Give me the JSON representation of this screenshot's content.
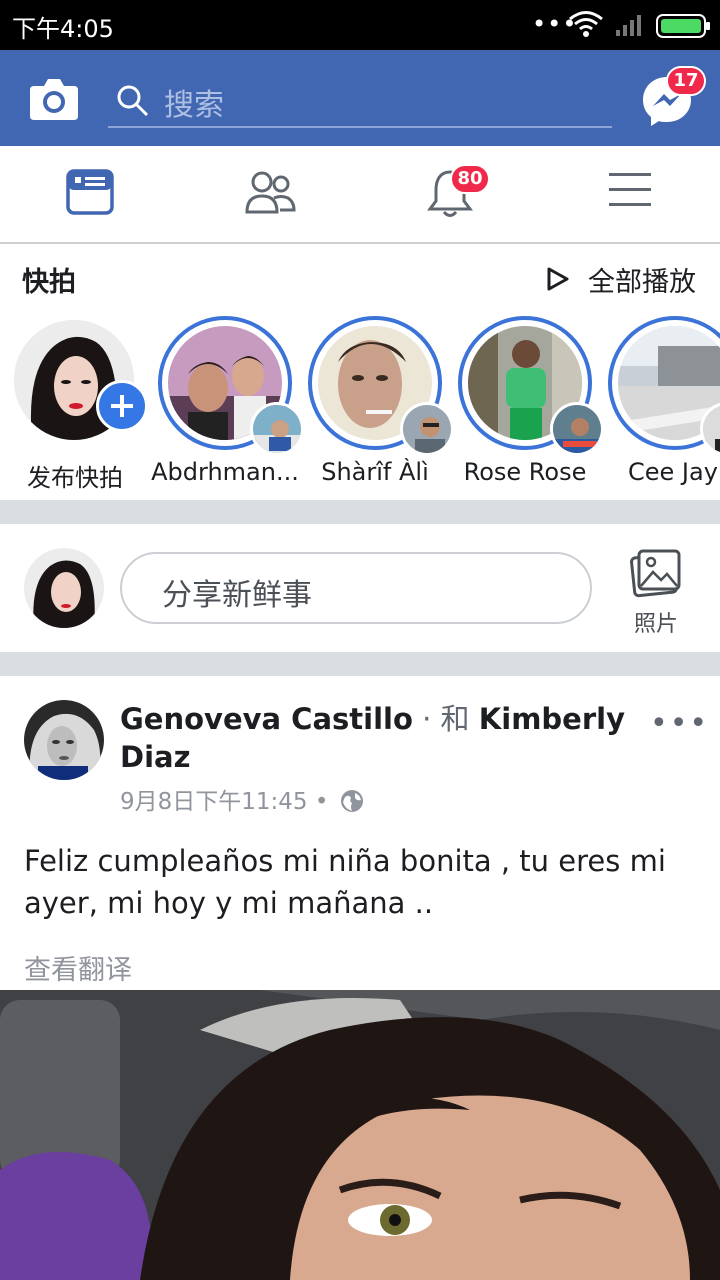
{
  "status_bar": {
    "time": "下午4:05",
    "dots": "•••"
  },
  "top_bar": {
    "search_placeholder": "搜索",
    "messenger_badge": "17"
  },
  "nav": {
    "notifications_badge": "80"
  },
  "stories": {
    "title": "快拍",
    "play_all": "全部播放",
    "items": [
      {
        "label": "发布快拍"
      },
      {
        "label": "Abdrhman..."
      },
      {
        "label": "Shàrîf Àlì"
      },
      {
        "label": "Rose Rose"
      },
      {
        "label": "Cee Jay"
      }
    ]
  },
  "composer": {
    "placeholder": "分享新鲜事",
    "photo_label": "照片"
  },
  "post": {
    "author": "Genoveva Castillo",
    "connector": " · 和 ",
    "tagged": "Kimberly Diaz",
    "time": "9月8日下午11:45 • ",
    "text": "Feliz cumpleaños mi niña bonita , tu eres mi ayer, mi hoy y mi mañana ..",
    "translate": "查看翻译",
    "more": "•••"
  },
  "colors": {
    "brand": "#4267b2",
    "badge": "#f02849",
    "story_ring": "#3b73d8",
    "add_button": "#3578e5",
    "divider": "#dadde1"
  },
  "icons": [
    "camera-icon",
    "search-icon",
    "messenger-icon",
    "news-feed-icon",
    "friends-icon",
    "bell-icon",
    "menu-icon",
    "play-icon",
    "plus-icon",
    "photo-icon",
    "globe-icon",
    "wifi-icon",
    "signal-icon",
    "battery-icon"
  ]
}
